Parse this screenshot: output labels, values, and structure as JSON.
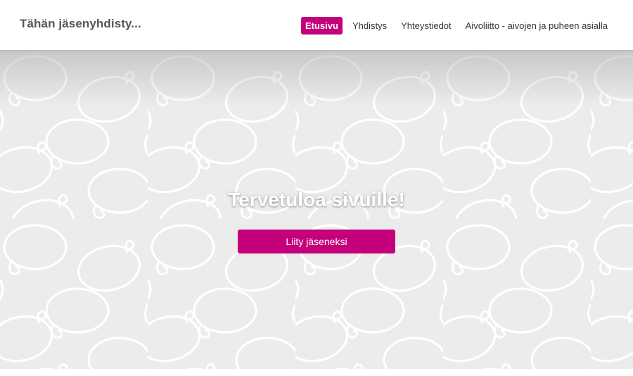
{
  "header": {
    "brand": "Tähän jäsenyhdisty...",
    "nav": [
      {
        "label": "Etusivu",
        "active": true
      },
      {
        "label": "Yhdistys",
        "active": false
      },
      {
        "label": "Yhteystiedot",
        "active": false
      },
      {
        "label": "Aivoliitto - aivojen ja puheen asialla",
        "active": false
      }
    ]
  },
  "hero": {
    "title": "Tervetuloa sivuille!",
    "button_label": "Liity jäseneksi",
    "background_icon": "speech-bubble-pattern"
  },
  "colors": {
    "accent": "#c4007a",
    "hero_background": "#ececec",
    "bubble_outline": "#ffffff"
  }
}
